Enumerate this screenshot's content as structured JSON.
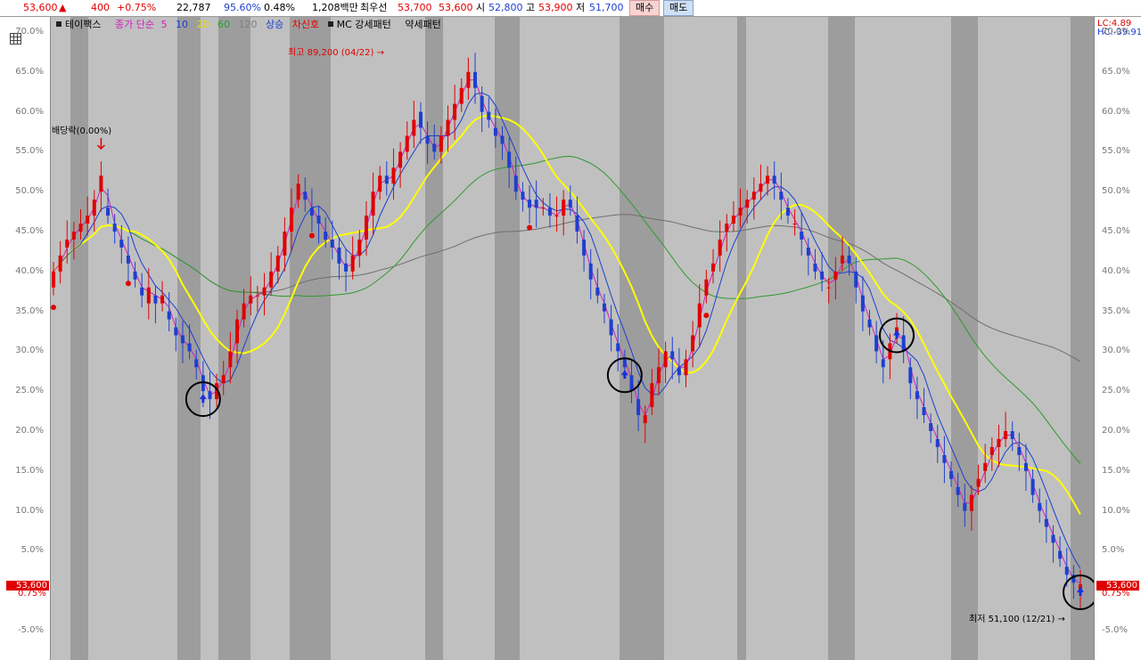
{
  "topbar": {
    "price": "53,600",
    "change_arrow": "▲",
    "change": "400",
    "change_pct": "+0.75%",
    "volume": "22,787",
    "vol_ratio": "95.60%",
    "turnover": "0.48%",
    "amount": "1,208백만",
    "best_bid_label": "최우선",
    "best_ask": "53,700",
    "best_bid": "53,600",
    "open_label": "시",
    "open": "52,800",
    "high_label": "고",
    "high": "53,900",
    "low_label": "저",
    "low": "51,700",
    "buy_label": "매수",
    "sell_label": "매도"
  },
  "legend": {
    "source": "테이팩스",
    "ma_label": "종가 단순",
    "ma5": "5",
    "ma10": "10",
    "ma20": "20",
    "ma60": "60",
    "ma120": "120",
    "up": "상승",
    "signal": "차신호",
    "pattern_strong": "MC 강세패턴",
    "pattern_weak": "약세패턴"
  },
  "right_axis": {
    "lc": "LC:4.89",
    "hc": "HC:-39.91"
  },
  "last_price": "53,600",
  "last_pct": "0.75%",
  "annotations": {
    "high": "최고 89,200 (04/22)",
    "low": "최저 51,100 (12/21)",
    "ex_div": "배당락(0.00%)"
  },
  "colors": {
    "up": "#e00000",
    "down": "#1d3fd0",
    "ma5": "#d020c0",
    "ma10": "#1d3fd0",
    "ma20": "#ffff00",
    "ma60": "#2f9a2f",
    "ma120": "#6e6e6e",
    "band_dark": "#9d9d9d",
    "band_light": "#bdbdbd"
  },
  "chart_data": {
    "type": "candlestick",
    "unit": "%",
    "y_ticks": [
      "70.0%",
      "65.0%",
      "60.0%",
      "55.0%",
      "50.0%",
      "45.0%",
      "40.0%",
      "35.0%",
      "30.0%",
      "25.0%",
      "20.0%",
      "15.0%",
      "10.0%",
      "5.0%",
      "-5.0%"
    ],
    "ylim": [
      -5,
      72
    ],
    "bars": 132,
    "close": [
      40,
      42,
      44,
      45,
      46,
      47,
      49,
      52,
      47,
      45,
      43,
      41,
      39,
      37,
      38,
      36,
      37,
      34,
      32,
      31,
      30,
      28,
      25,
      24,
      26,
      27,
      30,
      34,
      36,
      37,
      37,
      38,
      40,
      42,
      45,
      48,
      51,
      49,
      47,
      46,
      44,
      43,
      41,
      40,
      42,
      44,
      47,
      50,
      52,
      51,
      53,
      55,
      57,
      59,
      58,
      56,
      55,
      57,
      59,
      61,
      63,
      65,
      63,
      60,
      59,
      57,
      56,
      53,
      50,
      49,
      48,
      48,
      48,
      47,
      47,
      49,
      48,
      45,
      42,
      39,
      37,
      35,
      32,
      30,
      28,
      25,
      22,
      22,
      26,
      28,
      30,
      29,
      27,
      29,
      32,
      36,
      39,
      41,
      44,
      46,
      47,
      48,
      49,
      50,
      51,
      52,
      51,
      49,
      47,
      46,
      44,
      42,
      40,
      39,
      38,
      40,
      42,
      41,
      38,
      35,
      33,
      30,
      28,
      31,
      33,
      30,
      26,
      24,
      22,
      20,
      18,
      16,
      14,
      12,
      10,
      12,
      14,
      16,
      18,
      19,
      20,
      19,
      17,
      15,
      12,
      10,
      8,
      6,
      4,
      2,
      1,
      0.8
    ],
    "open": [
      38,
      40,
      43,
      44,
      45,
      46,
      47,
      50,
      48,
      46,
      44,
      42,
      40,
      38,
      36,
      37,
      36,
      35,
      33,
      32,
      31,
      29,
      27,
      25,
      24,
      26,
      28,
      31,
      34,
      36,
      37,
      37,
      38,
      40,
      42,
      45,
      49,
      50,
      48,
      47,
      45,
      44,
      43,
      41,
      40,
      42,
      44,
      47,
      50,
      52,
      51,
      53,
      55,
      57,
      60,
      57,
      56,
      55,
      57,
      59,
      61,
      63,
      65,
      62,
      60,
      58,
      57,
      55,
      52,
      50,
      49,
      49,
      48,
      48,
      47,
      47,
      49,
      47,
      44,
      41,
      38,
      36,
      34,
      31,
      29,
      27,
      24,
      21,
      23,
      26,
      28,
      30,
      28,
      27,
      30,
      33,
      37,
      40,
      42,
      45,
      46,
      47,
      48,
      49,
      50,
      51,
      52,
      50,
      48,
      46,
      45,
      43,
      41,
      40,
      38,
      39,
      41,
      42,
      40,
      37,
      34,
      32,
      29,
      29,
      32,
      32,
      28,
      25,
      23,
      21,
      19,
      17,
      15,
      13,
      11,
      10,
      13,
      15,
      17,
      18,
      19,
      20,
      18,
      16,
      14,
      11,
      9,
      7,
      5,
      3,
      2,
      0.2
    ],
    "ma5_color": "#d020c0",
    "ma10_color": "#1d3fd0",
    "ma20_color": "#ffff00",
    "ma60_color": "#2f9a2f",
    "ma120_color": "#6e6e6e",
    "signals": [
      {
        "type": "buy",
        "label": "circle"
      },
      {
        "type": "buy",
        "label": "circle"
      },
      {
        "type": "buy",
        "label": "circle"
      },
      {
        "type": "buy",
        "label": "circle"
      }
    ]
  }
}
